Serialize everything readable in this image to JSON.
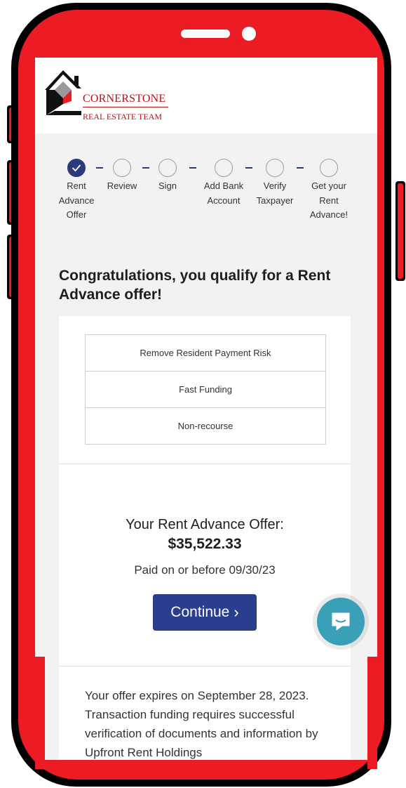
{
  "logo": {
    "name": "CORNERSTONE",
    "subtitle": "REAL ESTATE TEAM",
    "brand_color": "#b5121b"
  },
  "stepper": {
    "steps": [
      {
        "label": "Rent Advance Offer",
        "state": "completed"
      },
      {
        "label": "Review",
        "state": "pending"
      },
      {
        "label": "Sign",
        "state": "pending"
      },
      {
        "label": "Add Bank Account",
        "state": "pending"
      },
      {
        "label": "Verify Taxpayer",
        "state": "pending"
      },
      {
        "label": "Get your Rent Advance!",
        "state": "pending"
      }
    ],
    "accent": "#2b3a7a"
  },
  "main": {
    "headline": "Congratulations, you qualify for a Rent Advance offer!",
    "benefits": [
      "Remove Resident Payment Risk",
      "Fast Funding",
      "Non-recourse"
    ],
    "offer_title": "Your Rent Advance Offer:",
    "offer_amount": "$35,522.33",
    "offer_paid": "Paid on or before 09/30/23",
    "continue_label": "Continue",
    "expiry_text": "Your offer expires on September 28, 2023. Transaction funding requires successful verification of documents and information by Upfront Rent Holdings"
  },
  "chat": {
    "icon": "chat-icon",
    "color": "#3aa0b7"
  },
  "frame": {
    "color": "#ed1c24"
  }
}
